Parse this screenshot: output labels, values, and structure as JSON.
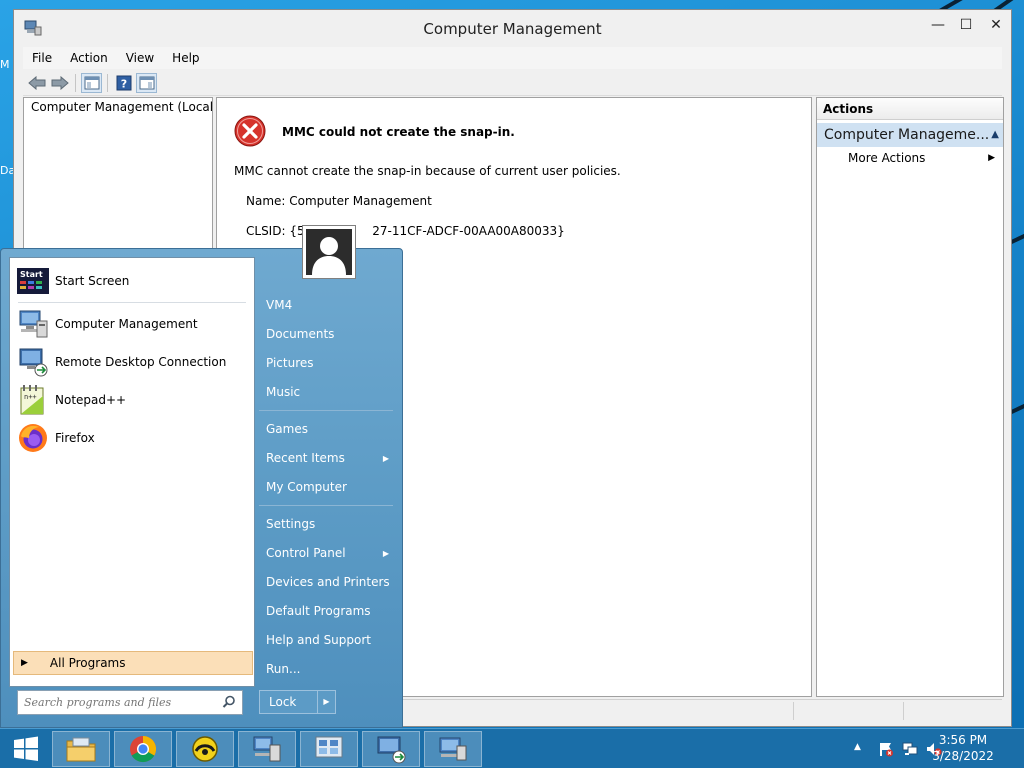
{
  "window": {
    "title": "Computer Management",
    "minimize_glyph": "—",
    "maximize_glyph": "☐",
    "close_glyph": "✕"
  },
  "menu": {
    "items": [
      "File",
      "Action",
      "View",
      "Help"
    ]
  },
  "toolbar": {
    "icons": [
      "back-icon",
      "forward-icon",
      "console-tree-icon",
      "help-icon",
      "action-pane-icon"
    ]
  },
  "tree": {
    "root_label": "Computer Management (Local"
  },
  "error": {
    "title": "MMC could not create the snap-in.",
    "description": "MMC cannot create the snap-in because of current user policies.",
    "name_line": "Name: Computer Management",
    "clsid_line": "CLSID: {58",
    "clsid_tail": "27-11CF-ADCF-00AA00A80033}"
  },
  "actions": {
    "header": "Actions",
    "section": "Computer Manageme...",
    "more_actions": "More Actions"
  },
  "start_menu": {
    "pinned": [
      {
        "label": "Start Screen",
        "icon": "start-screen-icon"
      },
      {
        "label": "Computer Management",
        "icon": "computer-management-icon"
      },
      {
        "label": "Remote Desktop Connection",
        "icon": "remote-desktop-icon"
      },
      {
        "label": "Notepad++",
        "icon": "notepadpp-icon"
      },
      {
        "label": "Firefox",
        "icon": "firefox-icon"
      }
    ],
    "start_tile_text": "Start",
    "all_programs": "All Programs",
    "search_placeholder": "Search programs and files",
    "right": {
      "group1": [
        "VM4",
        "Documents",
        "Pictures",
        "Music"
      ],
      "group2": [
        "Games",
        "Recent Items",
        "My Computer"
      ],
      "group3": [
        "Settings",
        "Control Panel",
        "Devices and Printers",
        "Default Programs",
        "Help and Support",
        "Run..."
      ]
    },
    "lock_label": "Lock",
    "submenu_arrow": "▶"
  },
  "taskbar": {
    "apps": [
      "file-explorer-icon",
      "chrome-icon",
      "app-icon",
      "computer-management-icon",
      "network-icon",
      "remote-desktop-icon",
      "computer-management-2-icon"
    ],
    "time": "3:56 PM",
    "date": "3/28/2022"
  },
  "desktop": {
    "left_letters": [
      "M",
      "Da"
    ]
  },
  "colors": {
    "accent": "#1a6ea8",
    "start_menu": "#5d9cc6",
    "selection": "#cfe1f2",
    "error_red": "#d32f2f"
  }
}
